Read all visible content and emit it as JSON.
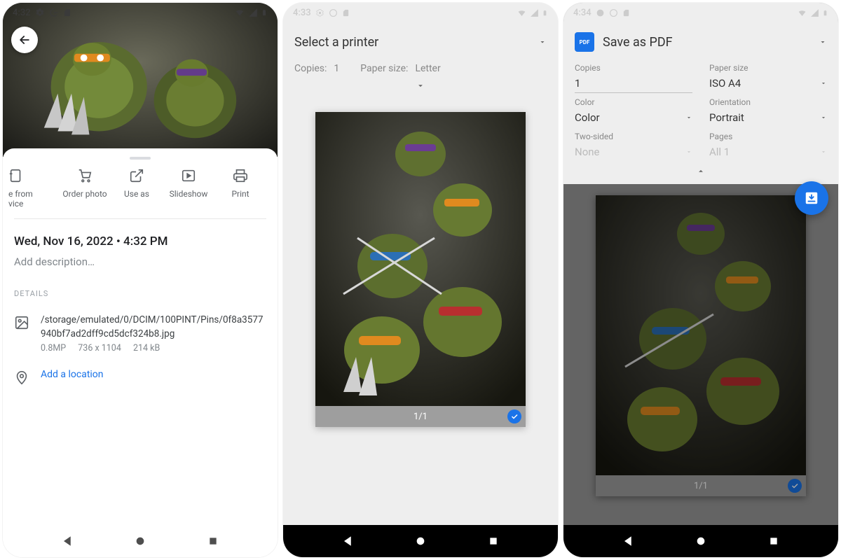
{
  "screen1": {
    "time": "4:32",
    "actions": {
      "delete": "e from\nvice",
      "order": "Order photo",
      "use_as": "Use as",
      "slideshow": "Slideshow",
      "print": "Print"
    },
    "date": "Wed, Nov 16, 2022  •  4:32 PM",
    "add_desc": "Add description…",
    "details_header": "DETAILS",
    "path": "/storage/emulated/0/DCIM/100PINT/Pins/0f8a3577940bf7ad2dff9cd5dcf324b8.jpg",
    "mp": "0.8MP",
    "dims": "736 x 1104",
    "size": "214 kB",
    "add_location": "Add a location"
  },
  "screen2": {
    "time": "4:33",
    "printer": "Select a printer",
    "copies_label": "Copies:",
    "copies_value": "1",
    "paper_label": "Paper size:",
    "paper_value": "Letter",
    "page_indicator": "1/1"
  },
  "screen3": {
    "time": "4:34",
    "title": "Save as PDF",
    "copies_label": "Copies",
    "copies_value": "1",
    "paper_label": "Paper size",
    "paper_value": "ISO A4",
    "color_label": "Color",
    "color_value": "Color",
    "orient_label": "Orientation",
    "orient_value": "Portrait",
    "twosided_label": "Two-sided",
    "twosided_value": "None",
    "pages_label": "Pages",
    "pages_value": "All 1",
    "page_indicator": "1/1"
  }
}
